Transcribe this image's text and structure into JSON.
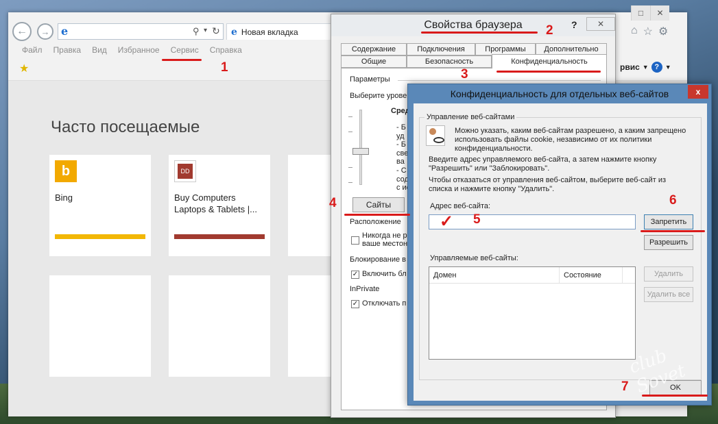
{
  "ie": {
    "new_tab_label": "Новая вкладка",
    "menu": [
      "Файл",
      "Правка",
      "Вид",
      "Избранное",
      "Сервис",
      "Справка"
    ],
    "service_label": "рвис",
    "frequent_title": "Часто посещаемые",
    "tiles": [
      {
        "label": "Bing",
        "accent": "#f2b705"
      },
      {
        "label": "Buy Computers\nLaptops & Tablets |...",
        "accent": "#a13a2f"
      }
    ]
  },
  "options": {
    "title": "Свойства браузера",
    "help": "?",
    "tabs_row1": [
      "Содержание",
      "Подключения",
      "Программы",
      "Дополнительно"
    ],
    "tabs_row2": [
      "Общие",
      "Безопасность",
      "Конфиденциальность"
    ],
    "params_label": "Параметры",
    "choose_level": "Выберите урове",
    "level_name": "Сред",
    "level_lines": [
      "- Б",
      "уд",
      "- Б",
      "све",
      "ва",
      "- С",
      "сод",
      "с ис"
    ],
    "sites_button": "Сайты",
    "location_label": "Расположение",
    "never_allow": "Никогда не р",
    "never_allow_2": "ваше местона",
    "blocking_label": "Блокирование в",
    "enable_blocking": "Включить бл",
    "inprivate_label": "InPrivate",
    "disable_label": "Отключать п"
  },
  "site_dialog": {
    "title": "Конфиденциальность для отдельных веб-сайтов",
    "close": "x",
    "group_label": "Управление веб-сайтами",
    "intro": "Можно указать, каким веб-сайтам разрешено, а каким запрещено использовать файлы cookie, независимо от их политики конфиденциальности.",
    "instruction1": "Введите адрес управляемого веб-сайта, а затем нажмите кнопку \"Разрешить\" или \"Заблокировать\".",
    "instruction2": "Чтобы отказаться от управления веб-сайтом, выберите веб-сайт из списка и нажмите кнопку \"Удалить\".",
    "address_label": "Адрес веб-сайта:",
    "address_value": "",
    "block_button": "Запретить",
    "allow_button": "Разрешить",
    "managed_label": "Управляемые веб-сайты:",
    "columns": [
      "Домен",
      "Состояние"
    ],
    "remove_button": "Удалить",
    "remove_all_button": "Удалить все",
    "ok_button": "OK"
  },
  "annotations": {
    "n1": "1",
    "n2": "2",
    "n3": "3",
    "n4": "4",
    "n5": "5",
    "n6": "6",
    "n7": "7",
    "color": "#d91a1a"
  },
  "watermark": "club Sovet"
}
